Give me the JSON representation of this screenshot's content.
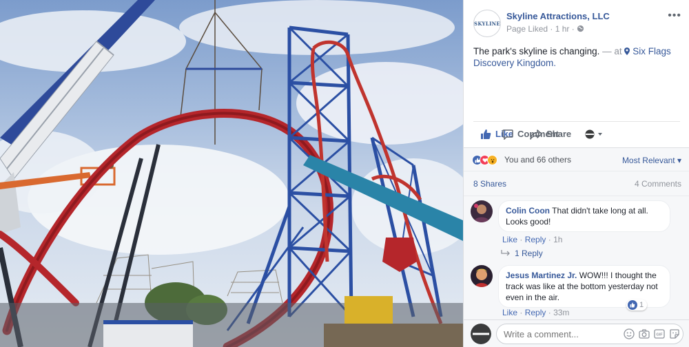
{
  "post": {
    "page_name": "Skyline Attractions, LLC",
    "avatar_text": "SKYLINE",
    "meta": "Page Liked · 1 hr ·",
    "text_main": "The park's skyline is changing.",
    "text_at": " — at ",
    "place": "Six Flags Discovery Kingdom."
  },
  "actions": {
    "like": "Like",
    "comment": "Comment",
    "share": "Share"
  },
  "reactions": {
    "summary": "You and 66 others",
    "sort": "Most Relevant ▾",
    "shares": "8 Shares",
    "comments_count": "4 Comments"
  },
  "comments": [
    {
      "author": "Colin Coon",
      "text": "That didn't take long at all. Looks good!",
      "like": "Like",
      "reply": "Reply",
      "time": "1h",
      "replies": "1 Reply"
    },
    {
      "author": "Jesus Martinez Jr.",
      "text": "WOW!!! I thought the track was like at the bottom yesterday not even in the air.",
      "like": "Like",
      "reply": "Reply",
      "time": "33m",
      "likes": "1"
    }
  ],
  "composer": {
    "placeholder": "Write a comment..."
  },
  "colors": {
    "link": "#365899",
    "action_active": "#4267b2",
    "muted": "#90949c",
    "panel_bg": "#f6f7f9"
  }
}
